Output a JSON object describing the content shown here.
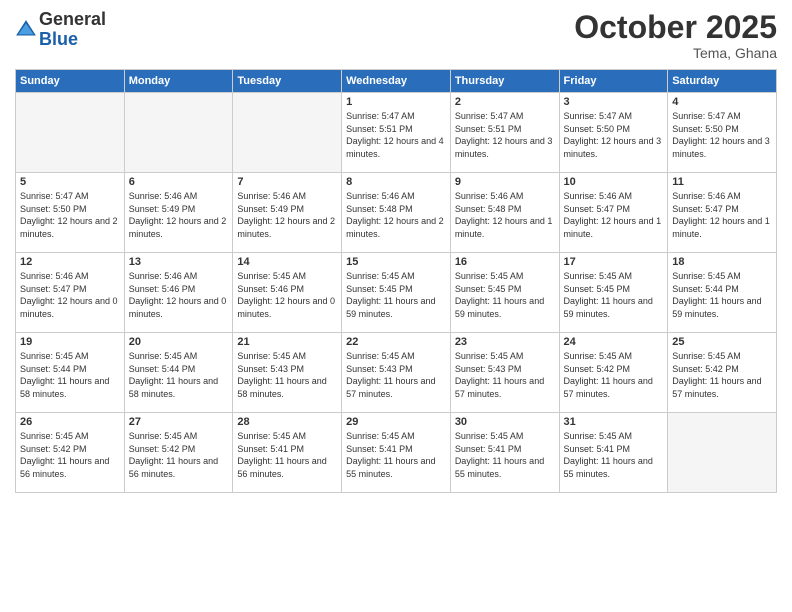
{
  "header": {
    "logo_general": "General",
    "logo_blue": "Blue",
    "month_title": "October 2025",
    "location": "Tema, Ghana"
  },
  "days_of_week": [
    "Sunday",
    "Monday",
    "Tuesday",
    "Wednesday",
    "Thursday",
    "Friday",
    "Saturday"
  ],
  "weeks": [
    [
      {
        "num": "",
        "empty": true
      },
      {
        "num": "",
        "empty": true
      },
      {
        "num": "",
        "empty": true
      },
      {
        "num": "1",
        "sunrise": "5:47 AM",
        "sunset": "5:51 PM",
        "daylight": "12 hours and 4 minutes."
      },
      {
        "num": "2",
        "sunrise": "5:47 AM",
        "sunset": "5:51 PM",
        "daylight": "12 hours and 3 minutes."
      },
      {
        "num": "3",
        "sunrise": "5:47 AM",
        "sunset": "5:50 PM",
        "daylight": "12 hours and 3 minutes."
      },
      {
        "num": "4",
        "sunrise": "5:47 AM",
        "sunset": "5:50 PM",
        "daylight": "12 hours and 3 minutes."
      }
    ],
    [
      {
        "num": "5",
        "sunrise": "5:47 AM",
        "sunset": "5:50 PM",
        "daylight": "12 hours and 2 minutes."
      },
      {
        "num": "6",
        "sunrise": "5:46 AM",
        "sunset": "5:49 PM",
        "daylight": "12 hours and 2 minutes."
      },
      {
        "num": "7",
        "sunrise": "5:46 AM",
        "sunset": "5:49 PM",
        "daylight": "12 hours and 2 minutes."
      },
      {
        "num": "8",
        "sunrise": "5:46 AM",
        "sunset": "5:48 PM",
        "daylight": "12 hours and 2 minutes."
      },
      {
        "num": "9",
        "sunrise": "5:46 AM",
        "sunset": "5:48 PM",
        "daylight": "12 hours and 1 minute."
      },
      {
        "num": "10",
        "sunrise": "5:46 AM",
        "sunset": "5:47 PM",
        "daylight": "12 hours and 1 minute."
      },
      {
        "num": "11",
        "sunrise": "5:46 AM",
        "sunset": "5:47 PM",
        "daylight": "12 hours and 1 minute."
      }
    ],
    [
      {
        "num": "12",
        "sunrise": "5:46 AM",
        "sunset": "5:47 PM",
        "daylight": "12 hours and 0 minutes."
      },
      {
        "num": "13",
        "sunrise": "5:46 AM",
        "sunset": "5:46 PM",
        "daylight": "12 hours and 0 minutes."
      },
      {
        "num": "14",
        "sunrise": "5:45 AM",
        "sunset": "5:46 PM",
        "daylight": "12 hours and 0 minutes."
      },
      {
        "num": "15",
        "sunrise": "5:45 AM",
        "sunset": "5:45 PM",
        "daylight": "11 hours and 59 minutes."
      },
      {
        "num": "16",
        "sunrise": "5:45 AM",
        "sunset": "5:45 PM",
        "daylight": "11 hours and 59 minutes."
      },
      {
        "num": "17",
        "sunrise": "5:45 AM",
        "sunset": "5:45 PM",
        "daylight": "11 hours and 59 minutes."
      },
      {
        "num": "18",
        "sunrise": "5:45 AM",
        "sunset": "5:44 PM",
        "daylight": "11 hours and 59 minutes."
      }
    ],
    [
      {
        "num": "19",
        "sunrise": "5:45 AM",
        "sunset": "5:44 PM",
        "daylight": "11 hours and 58 minutes."
      },
      {
        "num": "20",
        "sunrise": "5:45 AM",
        "sunset": "5:44 PM",
        "daylight": "11 hours and 58 minutes."
      },
      {
        "num": "21",
        "sunrise": "5:45 AM",
        "sunset": "5:43 PM",
        "daylight": "11 hours and 58 minutes."
      },
      {
        "num": "22",
        "sunrise": "5:45 AM",
        "sunset": "5:43 PM",
        "daylight": "11 hours and 57 minutes."
      },
      {
        "num": "23",
        "sunrise": "5:45 AM",
        "sunset": "5:43 PM",
        "daylight": "11 hours and 57 minutes."
      },
      {
        "num": "24",
        "sunrise": "5:45 AM",
        "sunset": "5:42 PM",
        "daylight": "11 hours and 57 minutes."
      },
      {
        "num": "25",
        "sunrise": "5:45 AM",
        "sunset": "5:42 PM",
        "daylight": "11 hours and 57 minutes."
      }
    ],
    [
      {
        "num": "26",
        "sunrise": "5:45 AM",
        "sunset": "5:42 PM",
        "daylight": "11 hours and 56 minutes."
      },
      {
        "num": "27",
        "sunrise": "5:45 AM",
        "sunset": "5:42 PM",
        "daylight": "11 hours and 56 minutes."
      },
      {
        "num": "28",
        "sunrise": "5:45 AM",
        "sunset": "5:41 PM",
        "daylight": "11 hours and 56 minutes."
      },
      {
        "num": "29",
        "sunrise": "5:45 AM",
        "sunset": "5:41 PM",
        "daylight": "11 hours and 55 minutes."
      },
      {
        "num": "30",
        "sunrise": "5:45 AM",
        "sunset": "5:41 PM",
        "daylight": "11 hours and 55 minutes."
      },
      {
        "num": "31",
        "sunrise": "5:45 AM",
        "sunset": "5:41 PM",
        "daylight": "11 hours and 55 minutes."
      },
      {
        "num": "",
        "empty": true
      }
    ]
  ]
}
